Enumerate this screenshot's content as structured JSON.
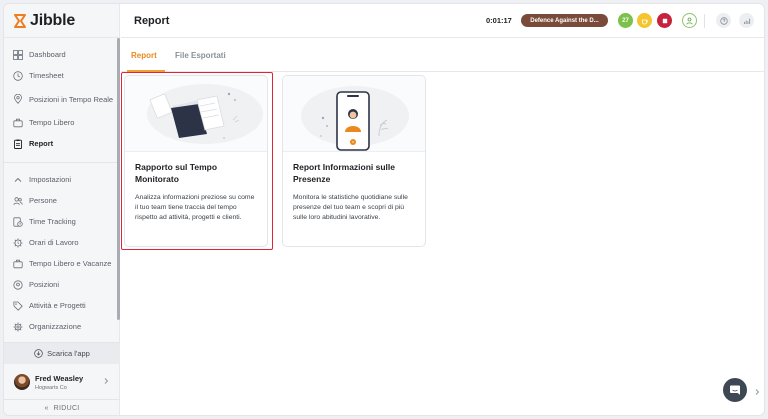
{
  "app": {
    "name": "Jibble"
  },
  "sidebar": {
    "nav": [
      {
        "label": "Dashboard",
        "icon": "dashboard-icon"
      },
      {
        "label": "Timesheet",
        "icon": "clock-icon"
      },
      {
        "label": "Posizioni in Tempo Reale",
        "icon": "location-pin-icon"
      },
      {
        "label": "Tempo Libero",
        "icon": "briefcase-icon"
      },
      {
        "label": "Report",
        "icon": "clipboard-icon",
        "active": true
      }
    ],
    "settings": [
      {
        "label": "Impostazioni",
        "icon": "chevron-up-icon"
      },
      {
        "label": "Persone",
        "icon": "people-icon"
      },
      {
        "label": "Time Tracking",
        "icon": "time-tracking-icon"
      },
      {
        "label": "Orari di Lavoro",
        "icon": "gear-clock-icon"
      },
      {
        "label": "Tempo Libero e Vacanze",
        "icon": "briefcase-icon"
      },
      {
        "label": "Posizioni",
        "icon": "location-pin-icon"
      },
      {
        "label": "Attività e Progetti",
        "icon": "tag-icon"
      },
      {
        "label": "Organizzazione",
        "icon": "gear-icon"
      }
    ],
    "download_label": "Scarica l'app",
    "user": {
      "name": "Fred Weasley",
      "org": "Hogwarts Co"
    },
    "collapse_label": "RIDUCI"
  },
  "header": {
    "title": "Report",
    "timer": "0:01:17",
    "activity": "Defence Against the D...",
    "status_buttons": [
      {
        "label": "27",
        "color": "#7cc24a"
      },
      {
        "label": "",
        "color": "#f5c42e"
      },
      {
        "label": "",
        "color": "#c8233c"
      }
    ]
  },
  "tabs": [
    {
      "label": "Report",
      "active": true
    },
    {
      "label": "File Esportati",
      "active": false
    }
  ],
  "cards": [
    {
      "title": "Rapporto sul Tempo Monitorato",
      "description": "Analizza informazioni preziose su come il tuo team tiene traccia del tempo rispetto ad attività, progetti e clienti."
    },
    {
      "title": "Report Informazioni sulle Presenze",
      "description": "Monitora le statistiche quotidiane sulle presenze del tuo team e scopri di più sulle loro abitudini lavorative."
    }
  ],
  "colors": {
    "accent": "#e9891e",
    "highlight": "#e0243a",
    "activity_pill": "#7a4b3a"
  }
}
